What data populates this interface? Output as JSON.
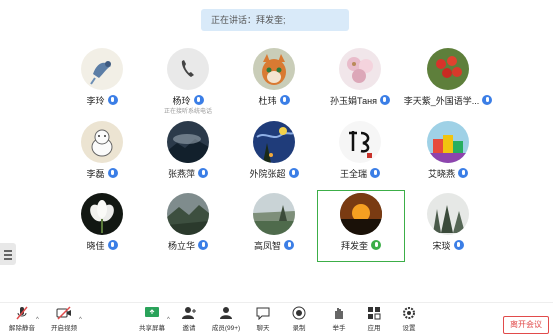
{
  "banner": {
    "text": "正在讲话：拜发奎;"
  },
  "participants": [
    {
      "name": "李玲",
      "avatar": "ink-bird-painting",
      "mic": "muted"
    },
    {
      "name": "杨玲",
      "avatar": "phone-icon",
      "mic": "muted",
      "subtext": "正在接听系统电话"
    },
    {
      "name": "杜玮",
      "avatar": "fox-cartoon",
      "mic": "muted"
    },
    {
      "name": "孙玉娟Таня",
      "avatar": "flowers-photo",
      "mic": "muted"
    },
    {
      "name": "李天紫_外国语学...",
      "avatar": "red-fruit-photo",
      "mic": "muted"
    },
    {
      "name": "李磊",
      "avatar": "cat-sketch",
      "mic": "muted"
    },
    {
      "name": "张燕萍",
      "avatar": "mountain-clouds",
      "mic": "muted"
    },
    {
      "name": "外院张超",
      "avatar": "starry-night-painting",
      "mic": "muted"
    },
    {
      "name": "王全瑞",
      "avatar": "calligraphy",
      "mic": "muted"
    },
    {
      "name": "艾晓燕",
      "avatar": "colorful-painting",
      "mic": "muted"
    },
    {
      "name": "晓佳",
      "avatar": "white-flower",
      "mic": "muted"
    },
    {
      "name": "杨立华",
      "avatar": "hills-photo",
      "mic": "muted"
    },
    {
      "name": "高凤智",
      "avatar": "landscape-photo",
      "mic": "muted"
    },
    {
      "name": "拜发奎",
      "avatar": "sunset-photo",
      "mic": "speaking"
    },
    {
      "name": "宋琰",
      "avatar": "misty-trees-photo",
      "mic": "muted"
    }
  ],
  "toolbar": {
    "unmute": "解除静音",
    "video": "开启视频",
    "share": "共享屏幕",
    "invite": "邀请",
    "members": "成员(99+)",
    "chat": "聊天",
    "record": "录制",
    "raise_hand": "举手",
    "apps": "应用",
    "settings": "设置",
    "leave": "离开会议"
  },
  "colors": {
    "accent": "#3b7ee6",
    "speaking": "#3cae48",
    "leave": "#e14b4b"
  }
}
